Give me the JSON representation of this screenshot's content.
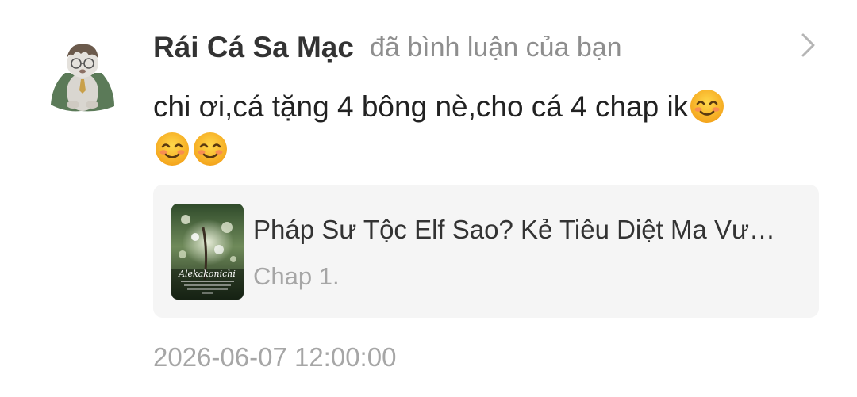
{
  "notification": {
    "username": "Rái Cá Sa Mạc",
    "action": "đã bình luận của bạn",
    "comment_text": "chi ơi,cá tặng 4 bông nè,cho cá 4 chap ik",
    "emojis": [
      "smiling-face-with-closed-eyes",
      "smiling-face-with-closed-eyes",
      "smiling-face-with-closed-eyes"
    ],
    "timestamp": "2026-06-07 12:00:00"
  },
  "card": {
    "title": "Pháp Sư Tộc Elf Sao? Kẻ Tiêu Diệt Ma Vư…",
    "chapter": "Chap 1.",
    "cover_signature": "Alekakonichi"
  },
  "colors": {
    "username": "#333333",
    "muted": "#8e8e8e",
    "timestamp": "#a6a6a6",
    "card_bg": "#f5f5f5"
  }
}
